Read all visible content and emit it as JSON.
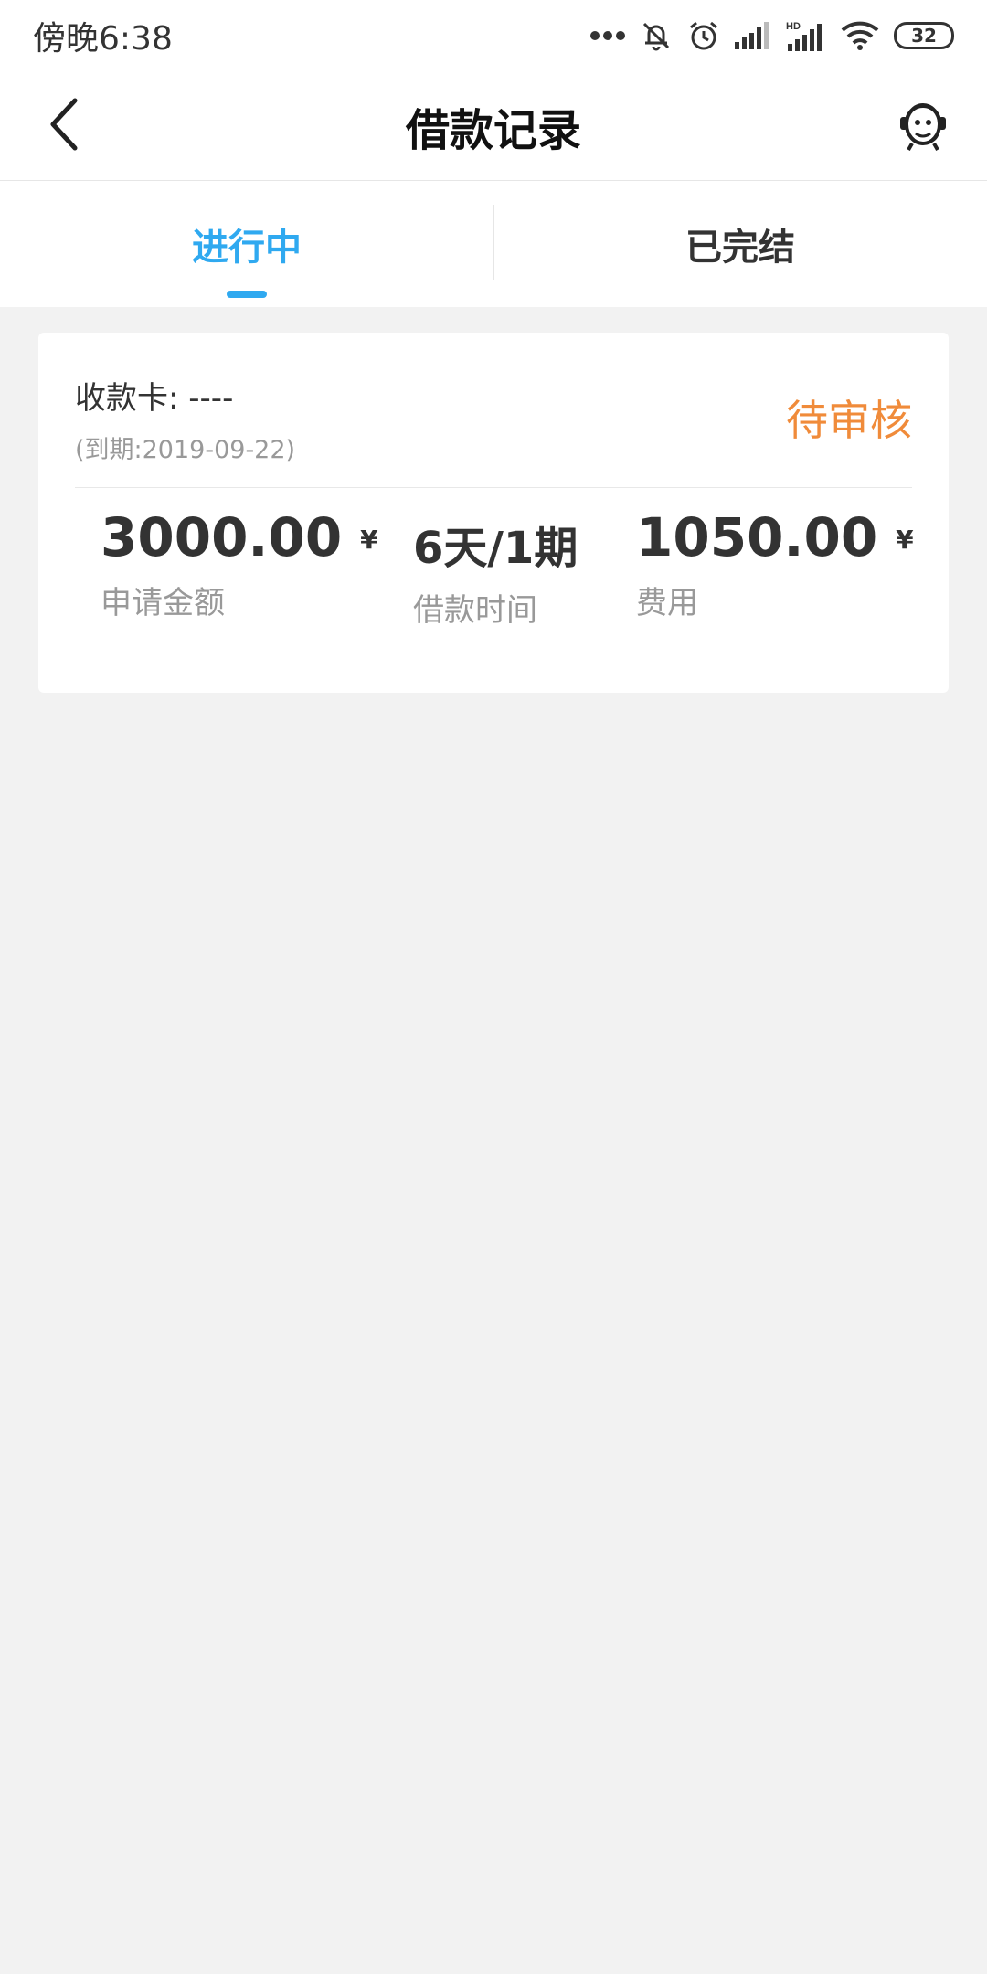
{
  "status_bar": {
    "time": "傍晚6:38",
    "battery": "32",
    "network_badge": "HD"
  },
  "header": {
    "title": "借款记录"
  },
  "tabs": [
    {
      "label": "进行中",
      "active": true
    },
    {
      "label": "已完结",
      "active": false
    }
  ],
  "record": {
    "card_label": "收款卡: ----",
    "due": "(到期:2019-09-22)",
    "status": "待审核",
    "amount": {
      "value": "3000.00",
      "unit": "¥",
      "label": "申请金额"
    },
    "term": {
      "value": "6天/1期",
      "label": "借款时间"
    },
    "fee": {
      "value": "1050.00",
      "unit": "¥",
      "label": "费用"
    }
  },
  "colors": {
    "accent_blue": "#2fa9f0",
    "status_orange": "#f08b3a",
    "background": "#f2f2f2"
  },
  "icons": [
    "back-arrow-icon",
    "customer-service-icon",
    "mute-icon",
    "alarm-icon",
    "signal-icon",
    "wifi-icon",
    "battery-icon"
  ]
}
